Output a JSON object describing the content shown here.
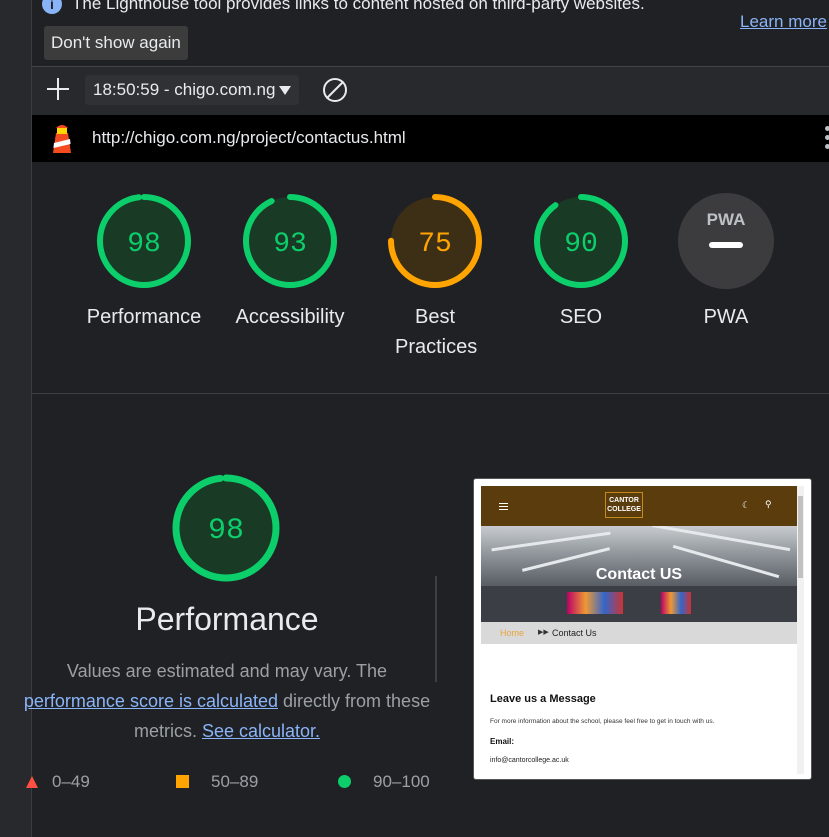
{
  "infobar": {
    "message": "The Lighthouse tool provides links to content hosted on third-party websites.",
    "learn_more": "Learn more",
    "dont_show": "Don't show again"
  },
  "toolbar": {
    "report": "18:50:59 - chigo.com.ng"
  },
  "urlbar": {
    "url": "http://chigo.com.ng/project/contactus.html"
  },
  "gauges": [
    {
      "label": "Performance",
      "score": "98",
      "value": 0.98,
      "color": "#0cce6b",
      "bg": "#193a24"
    },
    {
      "label": "Accessibility",
      "score": "93",
      "value": 0.93,
      "color": "#0cce6b",
      "bg": "#193a24"
    },
    {
      "label": "Best Practices",
      "score": "75",
      "value": 0.75,
      "color": "#ffa400",
      "bg": "#3d2f15"
    },
    {
      "label": "SEO",
      "score": "90",
      "value": 0.9,
      "color": "#0cce6b",
      "bg": "#193a24"
    },
    {
      "label": "PWA",
      "badge": "PWA"
    }
  ],
  "performance": {
    "score": "98",
    "value": 0.98,
    "title": "Performance",
    "desc_1": "Values are estimated and may vary. The",
    "desc_link": "performance score is calculated",
    "desc_2": "directly from these metrics.",
    "calc_link": "See calculator."
  },
  "legend": {
    "fail": "0–49",
    "average": "50–89",
    "pass": "90–100"
  },
  "screenshot": {
    "logo_line1": "CANTOR",
    "logo_line2": "COLLEGE",
    "hero_title": "Contact US",
    "crumb_home": "Home",
    "crumb_current": "Contact Us",
    "heading": "Leave us a Message",
    "info": "For more information about the school, please feel free to get in touch with us.",
    "email_label": "Email:",
    "email": "info@cantorcollege.ac.uk"
  },
  "colors": {
    "pass": "#0cce6b",
    "average": "#ffa400",
    "fail": "#ff4e42",
    "link": "#8ab4f8"
  }
}
